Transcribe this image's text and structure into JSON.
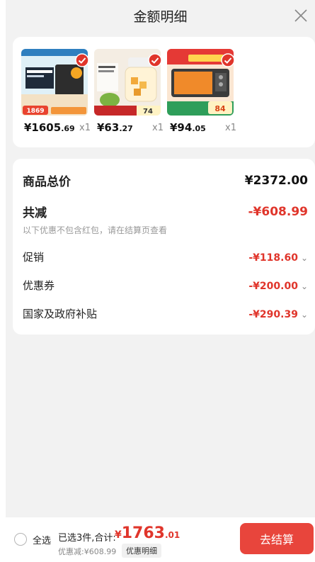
{
  "header": {
    "title": "金额明细",
    "close_icon": "close-icon"
  },
  "products": [
    {
      "price_int": "¥1605",
      "price_dec": ".69",
      "qty": "x1",
      "thumb_caption": "1869",
      "thumb_theme": "#e9432f"
    },
    {
      "price_int": "¥63",
      "price_dec": ".27",
      "qty": "x1",
      "thumb_caption": "74",
      "thumb_theme": "#c62828"
    },
    {
      "price_int": "¥94",
      "price_dec": ".05",
      "qty": "x1",
      "thumb_caption": "84",
      "thumb_theme": "#e53935"
    }
  ],
  "summary": {
    "total_label": "商品总价",
    "total_value": "¥2372.00",
    "reduce_label": "共减",
    "reduce_value": "-¥608.99",
    "note": "以下优惠不包含红包，请在结算页查看",
    "items": [
      {
        "label": "促销",
        "value": "-¥118.60"
      },
      {
        "label": "优惠券",
        "value": "-¥200.00"
      },
      {
        "label": "国家及政府补贴",
        "value": "-¥290.39"
      }
    ]
  },
  "bottom": {
    "select_all": "全选",
    "selected": "已选3件,合计:",
    "currency": "¥",
    "amount_int": "1763",
    "amount_dec": ".01",
    "discount": "优惠减:¥608.99",
    "detail_chip": "优惠明细",
    "checkout": "去结算"
  },
  "colors": {
    "accent": "#e0352b",
    "button": "#e8453c",
    "background": "#f2f2f2"
  }
}
